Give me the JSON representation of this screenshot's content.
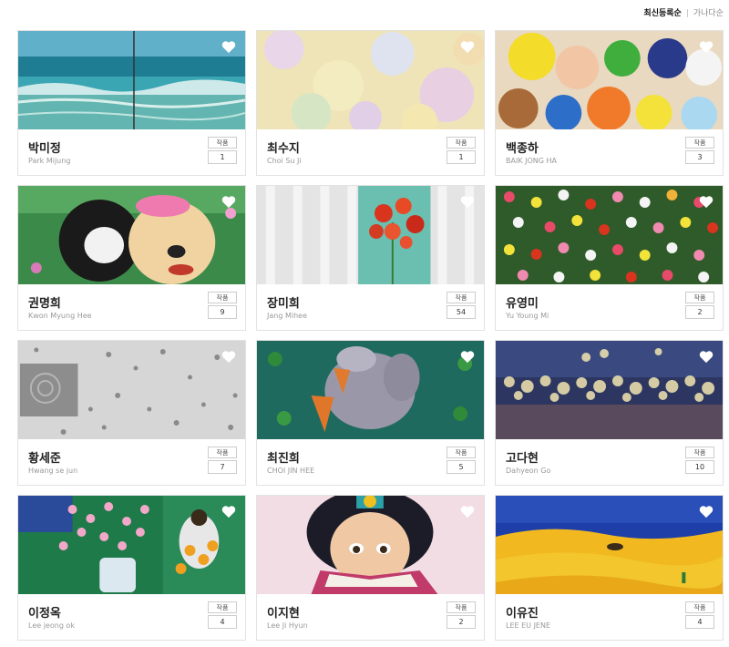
{
  "sort": {
    "active": "최신등록순",
    "other": "가나다순"
  },
  "works_label": "작품",
  "artists": [
    {
      "name_ko": "박미정",
      "name_en": "Park Mijung",
      "works": "1",
      "image": "ocean-waves-painting"
    },
    {
      "name_ko": "최수지",
      "name_en": "Choi Su Ji",
      "works": "1",
      "image": "pastel-blossom-painting"
    },
    {
      "name_ko": "백종하",
      "name_en": "BAIK JONG HA",
      "works": "3",
      "image": "cartoon-characters-collage"
    },
    {
      "name_ko": "권명희",
      "name_en": "Kwon Myung Hee",
      "works": "9",
      "image": "cat-and-dog-painting"
    },
    {
      "name_ko": "장미희",
      "name_en": "Jang Mihee",
      "works": "54",
      "image": "red-flowers-window-painting"
    },
    {
      "name_ko": "유영미",
      "name_en": "Yu Young Mi",
      "works": "2",
      "image": "flower-field-painting"
    },
    {
      "name_ko": "황세준",
      "name_en": "Hwang se jun",
      "works": "7",
      "image": "grey-texture-painting"
    },
    {
      "name_ko": "최진희",
      "name_en": "CHOI JIN HEE",
      "works": "5",
      "image": "rabbit-carrots-painting"
    },
    {
      "name_ko": "고다현",
      "name_en": "Dahyeon Go",
      "works": "10",
      "image": "night-bokeh-painting"
    },
    {
      "name_ko": "이정옥",
      "name_en": "Lee jeong ok",
      "works": "4",
      "image": "plum-blossom-vase-painting"
    },
    {
      "name_ko": "이지현",
      "name_en": "Lee Ji Hyun",
      "works": "2",
      "image": "girl-reading-book-painting"
    },
    {
      "name_ko": "이유진",
      "name_en": "LEE EU JENE",
      "works": "4",
      "image": "desert-landscape-painting"
    }
  ]
}
